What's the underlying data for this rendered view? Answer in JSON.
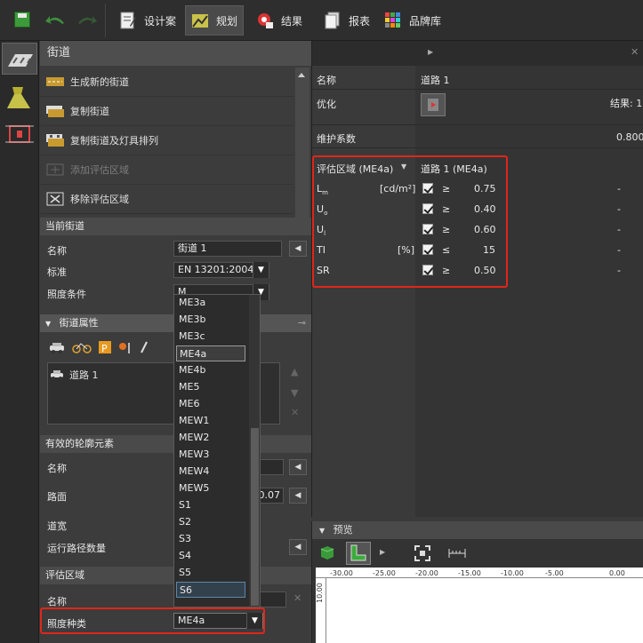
{
  "toolbar": {
    "tabs": [
      {
        "label": "设计案",
        "icon": "design-icon"
      },
      {
        "label": "规划",
        "icon": "planning-icon",
        "active": true
      },
      {
        "label": "结果",
        "icon": "results-icon"
      },
      {
        "label": "报表",
        "icon": "report-icon"
      },
      {
        "label": "品牌库",
        "icon": "brand-library-icon"
      }
    ]
  },
  "street_panel": {
    "title": "街道",
    "commands": [
      {
        "label": "生成新的街道",
        "enabled": true
      },
      {
        "label": "复制街道",
        "enabled": true
      },
      {
        "label": "复制街道及灯具排列",
        "enabled": true
      },
      {
        "label": "添加评估区域",
        "enabled": false
      },
      {
        "label": "移除评估区域",
        "enabled": true
      }
    ]
  },
  "current_street": {
    "title": "当前街道",
    "name_label": "名称",
    "name_value": "街道 1",
    "standard_label": "标准",
    "standard_value": "EN 13201:2004",
    "lighting_label": "照度条件",
    "lighting_value_partial": "M"
  },
  "street_properties": {
    "title": "街道属性",
    "items": [
      "道路 1"
    ]
  },
  "profile_elements": {
    "title": "有效的轮廓元素",
    "name_label": "名称",
    "surface_label": "路面",
    "surface_value": "0.07",
    "width_label": "道宽",
    "lanes_label": "运行路径数量"
  },
  "eval_area": {
    "title": "评估区域",
    "name_label": "名称",
    "type_label": "照度种类",
    "type_value": "ME4a"
  },
  "dropdown": {
    "options": [
      "ME3a",
      "ME3b",
      "ME3c",
      "ME4a",
      "ME4b",
      "ME5",
      "ME6",
      "MEW1",
      "MEW2",
      "MEW3",
      "MEW4",
      "MEW5",
      "S1",
      "S2",
      "S3",
      "S4",
      "S5",
      "S6"
    ],
    "selected": "ME4a",
    "hovered": "S6"
  },
  "grid": {
    "name_label": "名称",
    "name_value": "道路 1",
    "optimize_label": "优化",
    "result_label": "结果: 1",
    "maintenance_label": "维护系数",
    "maintenance_value": "0.800",
    "eval_area_label": "评估区域 (ME4a)",
    "eval_area_value": "道路 1 (ME4a)",
    "rows": [
      {
        "param": "Lm",
        "unit": "[cd/m²]",
        "op": "≥",
        "value": "0.75",
        "result": "-"
      },
      {
        "param": "Uo",
        "unit": "",
        "op": "≥",
        "value": "0.40",
        "result": "-"
      },
      {
        "param": "Ul",
        "unit": "",
        "op": "≥",
        "value": "0.60",
        "result": "-"
      },
      {
        "param": "TI",
        "unit": "[%]",
        "op": "≤",
        "value": "15",
        "result": "-"
      },
      {
        "param": "SR",
        "unit": "",
        "op": "≥",
        "value": "0.50",
        "result": "-"
      }
    ]
  },
  "preview": {
    "title": "预览",
    "ruler_ticks": [
      "-30.00",
      "-25.00",
      "-20.00",
      "-15.00",
      "-10.00",
      "-5.00",
      "0.00"
    ],
    "vertical_tick": "10.00"
  },
  "colors": {
    "highlight_red": "#e0261a",
    "panel_bg": "#3c3c3c"
  }
}
